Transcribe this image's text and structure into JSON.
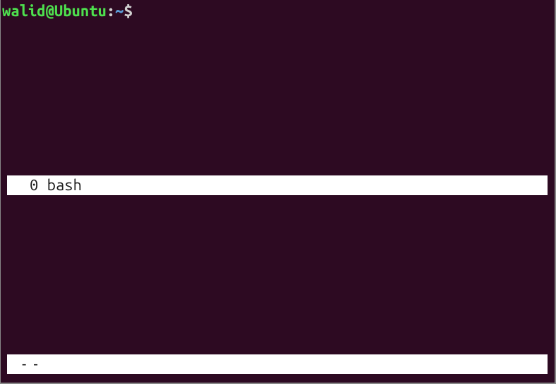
{
  "prompt": {
    "user_host": "walid@Ubuntu",
    "colon": ":",
    "path": "~",
    "sigil": "$"
  },
  "screen_list": {
    "items": [
      {
        "index": "0",
        "name": "bash"
      }
    ]
  },
  "status_bar": {
    "text": "--"
  }
}
